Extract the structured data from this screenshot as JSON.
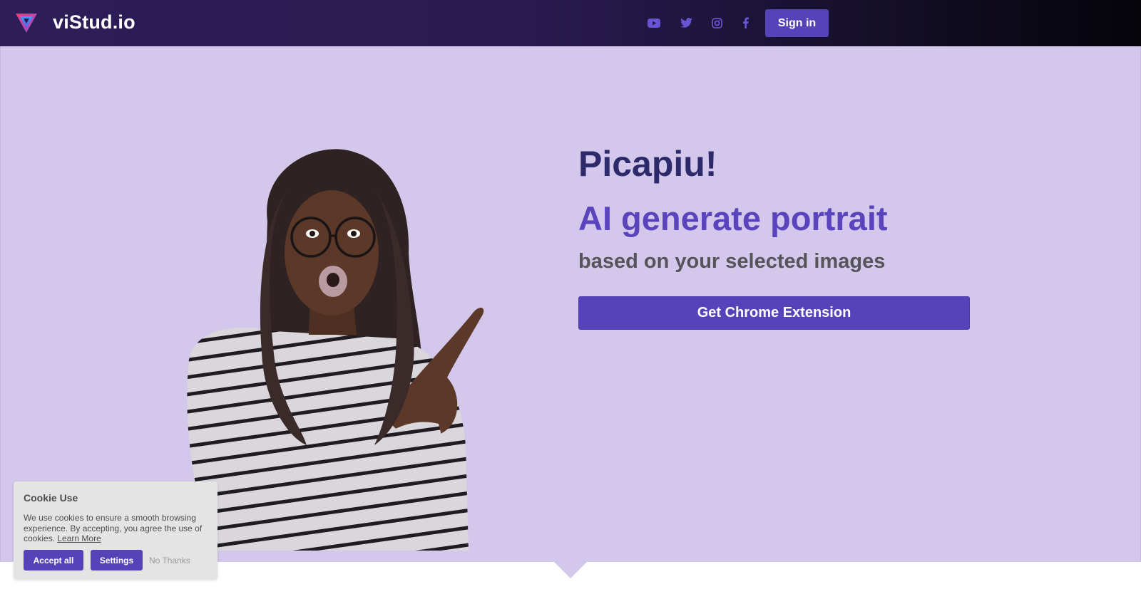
{
  "header": {
    "brand": "viStud.io",
    "signin_label": "Sign in",
    "social": [
      "youtube-icon",
      "twitter-icon",
      "instagram-icon",
      "facebook-icon"
    ]
  },
  "hero": {
    "title": "Picapiu!",
    "subtitle": "AI generate portrait",
    "description": "based on your selected images",
    "cta_label": "Get Chrome Extension"
  },
  "cookie": {
    "title": "Cookie Use",
    "text": "We use cookies to ensure a smooth browsing experience. By accepting, you agree the use of cookies.",
    "learn_more": "Learn More",
    "accept_label": "Accept all",
    "settings_label": "Settings",
    "no_thanks_label": "No Thanks"
  },
  "colors": {
    "accent": "#5743b9",
    "hero_bg": "#d4c7ec",
    "title": "#2d2a6c",
    "header_dark": "#2d1d58"
  }
}
